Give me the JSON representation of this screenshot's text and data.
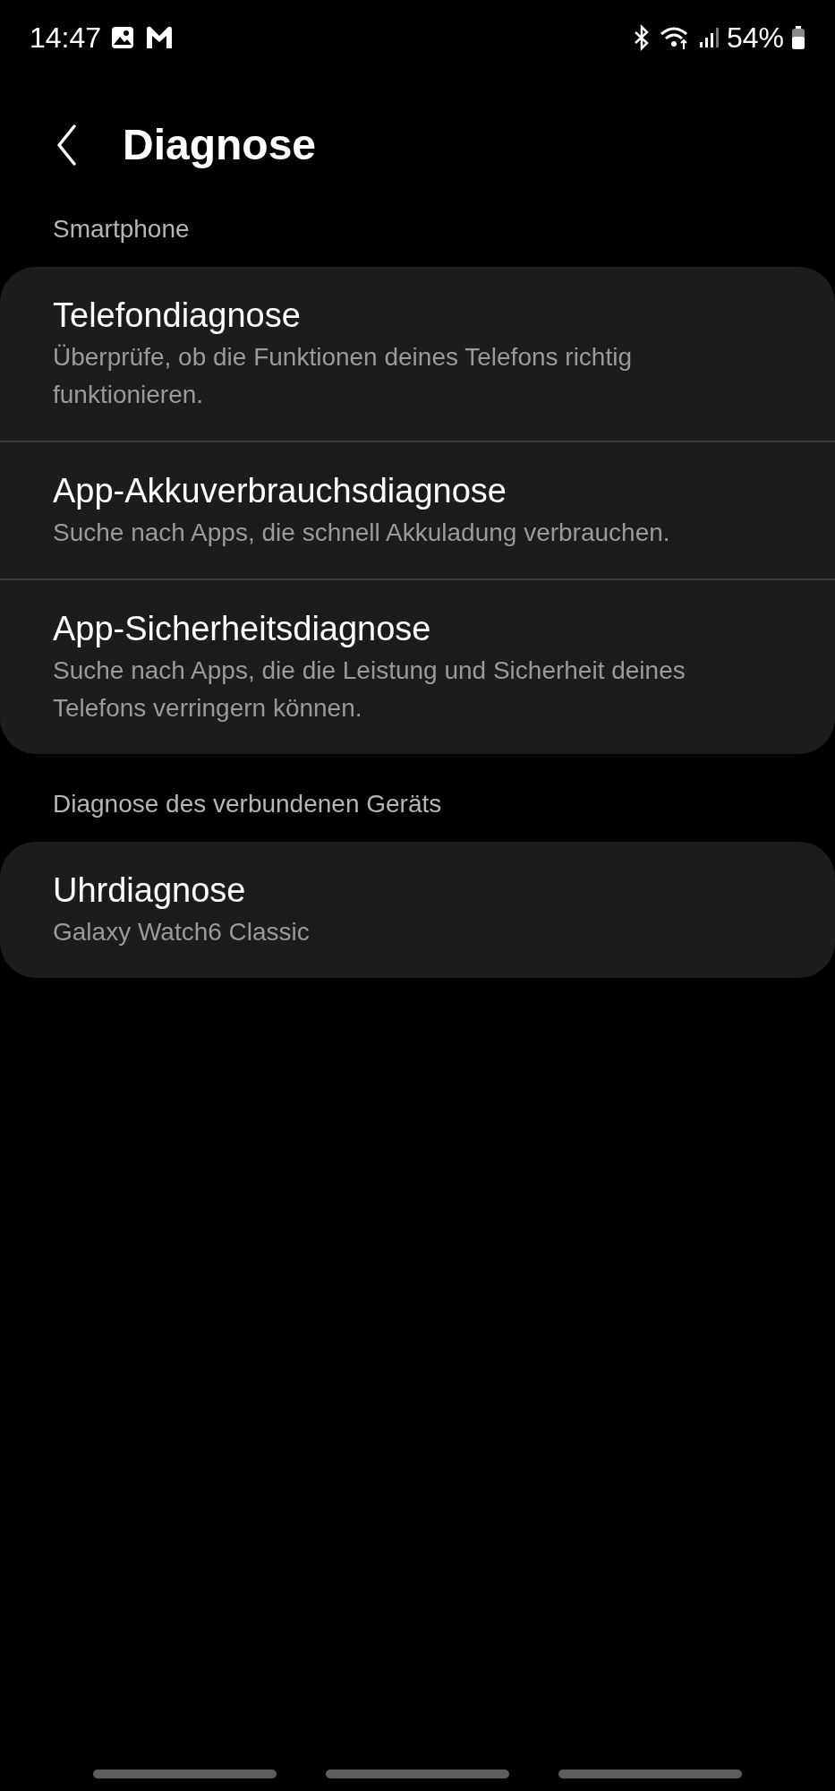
{
  "status_bar": {
    "time": "14:47",
    "battery": "54%"
  },
  "header": {
    "title": "Diagnose"
  },
  "sections": [
    {
      "label": "Smartphone",
      "items": [
        {
          "title": "Telefondiagnose",
          "subtitle": "Überprüfe, ob die Funktionen deines Telefons richtig funktionieren."
        },
        {
          "title": "App-Akkuverbrauchsdiagnose",
          "subtitle": "Suche nach Apps, die schnell Akkuladung verbrauchen."
        },
        {
          "title": "App-Sicherheitsdiagnose",
          "subtitle": "Suche nach Apps, die die Leistung und Sicherheit deines Telefons verringern können."
        }
      ]
    },
    {
      "label": "Diagnose des verbundenen Geräts",
      "items": [
        {
          "title": "Uhrdiagnose",
          "subtitle": "Galaxy Watch6 Classic"
        }
      ]
    }
  ]
}
